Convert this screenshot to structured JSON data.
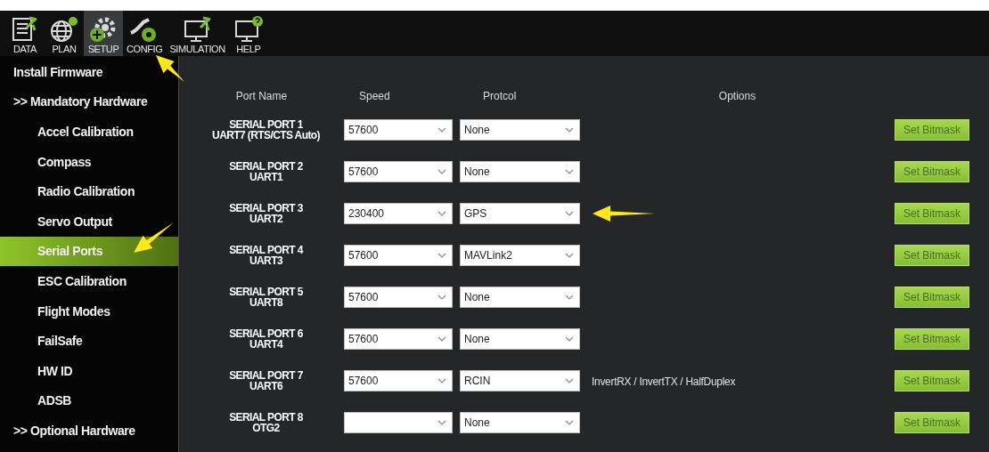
{
  "toolbar": [
    {
      "label": "DATA",
      "selected": false
    },
    {
      "label": "PLAN",
      "selected": false
    },
    {
      "label": "SETUP",
      "selected": true
    },
    {
      "label": "CONFIG",
      "selected": false
    },
    {
      "label": "SIMULATION",
      "selected": false
    },
    {
      "label": "HELP",
      "selected": false
    }
  ],
  "sidebar": {
    "items": [
      {
        "label": "Install Firmware",
        "selected": false
      },
      {
        "label": ">> Mandatory Hardware",
        "selected": false,
        "children": [
          {
            "label": "Accel Calibration",
            "selected": false
          },
          {
            "label": "Compass",
            "selected": false
          },
          {
            "label": "Radio Calibration",
            "selected": false
          },
          {
            "label": "Servo Output",
            "selected": false
          },
          {
            "label": "Serial Ports",
            "selected": true
          },
          {
            "label": "ESC Calibration",
            "selected": false
          },
          {
            "label": "Flight Modes",
            "selected": false
          },
          {
            "label": "FailSafe",
            "selected": false
          },
          {
            "label": "HW ID",
            "selected": false
          },
          {
            "label": "ADSB",
            "selected": false
          }
        ]
      },
      {
        "label": ">> Optional Hardware",
        "selected": false
      }
    ]
  },
  "ports": {
    "columns": [
      "Port Name",
      "Speed",
      "Protcol",
      "Options"
    ],
    "rows": [
      {
        "name": "SERIAL PORT 1",
        "uart": "UART7 (RTS/CTS Auto)",
        "speed": "57600",
        "protocol": "None",
        "button": "Set Bitmask"
      },
      {
        "name": "SERIAL PORT 2",
        "uart": "UART1",
        "speed": "57600",
        "protocol": "None",
        "button": "Set Bitmask"
      },
      {
        "name": "SERIAL PORT 3",
        "uart": "UART2",
        "speed": "230400",
        "protocol": "GPS",
        "button": "Set Bitmask"
      },
      {
        "name": "SERIAL PORT 4",
        "uart": "UART3",
        "speed": "57600",
        "protocol": "MAVLink2",
        "button": "Set Bitmask"
      },
      {
        "name": "SERIAL PORT 5",
        "uart": "UART8",
        "speed": "57600",
        "protocol": "None",
        "button": "Set Bitmask"
      },
      {
        "name": "SERIAL PORT 6",
        "uart": "UART4",
        "speed": "57600",
        "protocol": "None",
        "button": "Set Bitmask"
      },
      {
        "name": "SERIAL PORT 7",
        "uart": "UART6",
        "speed": "57600",
        "protocol": "RCIN",
        "options": "InvertRX / InvertTX / HalfDuplex",
        "button": "Set Bitmask"
      },
      {
        "name": "SERIAL PORT 8",
        "uart": "OTG2",
        "protocol": "None",
        "button": "Set Bitmask"
      }
    ]
  }
}
